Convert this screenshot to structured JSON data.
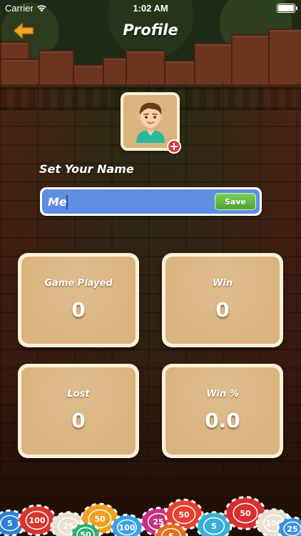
{
  "status_bar": {
    "carrier": "Carrier",
    "time": "1:02 AM"
  },
  "header": {
    "title": "Profile",
    "back_icon": "arrow-left-icon"
  },
  "avatar": {
    "icon": "boy-avatar-icon",
    "add_icon": "plus-icon",
    "add_symbol": "+"
  },
  "name_section": {
    "label": "Set Your Name",
    "value": "Me",
    "save_label": "Save"
  },
  "stats": [
    {
      "label": "Game Played",
      "value": "0"
    },
    {
      "label": "Win",
      "value": "0"
    },
    {
      "label": "Lost",
      "value": "0"
    },
    {
      "label": "Win %",
      "value": "0.0"
    }
  ],
  "chips": [
    "5",
    "100",
    "25",
    "50",
    "100",
    "25",
    "50",
    "5",
    "50",
    "100",
    "25",
    "50",
    "5"
  ],
  "colors": {
    "card_border": "#fbf1d6",
    "card_fill": "#d9b47e",
    "input_fill": "#5d8ee0",
    "save_green": "#4ba52f",
    "back_arrow": "#f2a626",
    "add_red": "#d93a3a"
  }
}
